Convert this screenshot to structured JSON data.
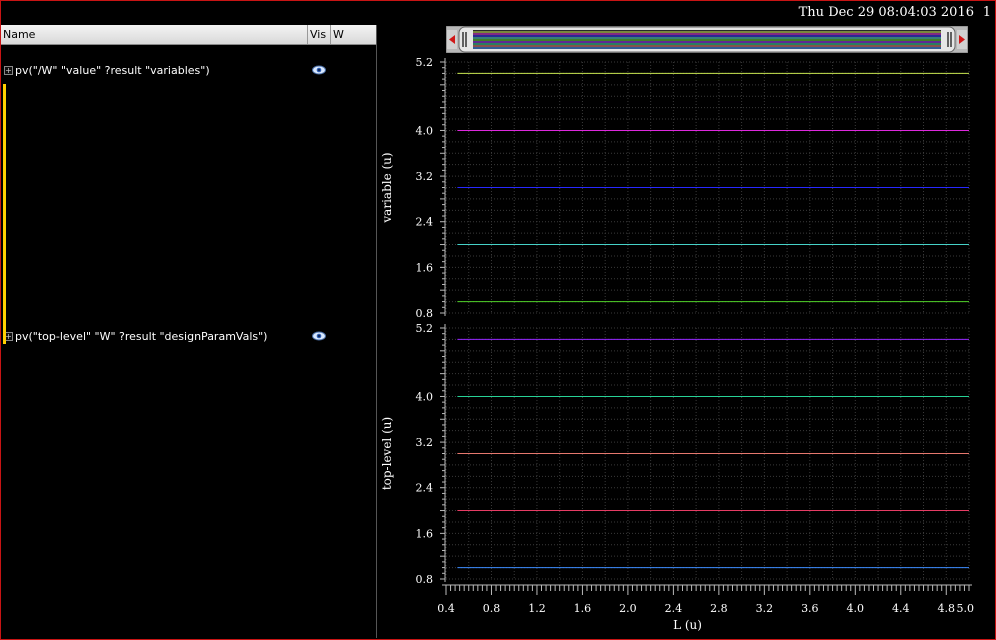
{
  "timestamp": "Thu Dec 29 08:04:03 2016",
  "page_number": "1",
  "browser": {
    "columns": {
      "name": "Name",
      "vis": "Vis",
      "w": "W"
    },
    "rows": [
      {
        "label": "pv(\"/W\" \"value\" ?result \"variables\")",
        "expander": "+"
      },
      {
        "label": "pv(\"top-level\" \"W\" ?result \"designParamVals\")",
        "expander": "+"
      }
    ]
  },
  "colors": {
    "frame": "#c81414",
    "highlight": "#ffd000",
    "grid": "#3a3a3a"
  },
  "chart_data": [
    {
      "type": "line",
      "xlabel": "L (u)",
      "ylabel": "variable (u)",
      "xlim": [
        0.4,
        5.0
      ],
      "ylim": [
        0.8,
        5.2
      ],
      "y_ticks": [
        "0.8",
        "1.6",
        "2.4",
        "3.2",
        "4.0",
        "5.2"
      ],
      "y_tick_values": [
        0.8,
        1.6,
        2.4,
        3.2,
        4.0,
        5.2
      ],
      "grid": true,
      "series": [
        {
          "x": [
            0.5,
            5.0
          ],
          "y": [
            5.0,
            5.0
          ],
          "color": "#c8e650"
        },
        {
          "x": [
            0.5,
            5.0
          ],
          "y": [
            4.0,
            4.0
          ],
          "color": "#dc28dc"
        },
        {
          "x": [
            0.5,
            5.0
          ],
          "y": [
            3.0,
            3.0
          ],
          "color": "#2828ff"
        },
        {
          "x": [
            0.5,
            5.0
          ],
          "y": [
            2.0,
            2.0
          ],
          "color": "#46d2c8"
        },
        {
          "x": [
            0.5,
            5.0
          ],
          "y": [
            1.0,
            1.0
          ],
          "color": "#50d228"
        }
      ]
    },
    {
      "type": "line",
      "xlabel": "L (u)",
      "ylabel": "top-level (u)",
      "xlim": [
        0.4,
        5.0
      ],
      "ylim": [
        0.8,
        5.2
      ],
      "y_ticks": [
        "0.8",
        "1.6",
        "2.4",
        "3.2",
        "4.0",
        "5.2"
      ],
      "y_tick_values": [
        0.8,
        1.6,
        2.4,
        3.2,
        4.0,
        5.2
      ],
      "x_ticks": [
        "0.4",
        "0.8",
        "1.2",
        "1.6",
        "2.0",
        "2.4",
        "2.8",
        "3.2",
        "3.6",
        "4.0",
        "4.4",
        "4.8",
        "5.0"
      ],
      "x_tick_values": [
        0.4,
        0.8,
        1.2,
        1.6,
        2.0,
        2.4,
        2.8,
        3.2,
        3.6,
        4.0,
        4.4,
        4.8,
        5.0
      ],
      "grid": true,
      "series": [
        {
          "x": [
            0.5,
            5.0
          ],
          "y": [
            5.0,
            5.0
          ],
          "color": "#9628ff"
        },
        {
          "x": [
            0.5,
            5.0
          ],
          "y": [
            4.0,
            4.0
          ],
          "color": "#28d296"
        },
        {
          "x": [
            0.5,
            5.0
          ],
          "y": [
            3.0,
            3.0
          ],
          "color": "#e6786e"
        },
        {
          "x": [
            0.5,
            5.0
          ],
          "y": [
            2.0,
            2.0
          ],
          "color": "#e63c64"
        },
        {
          "x": [
            0.5,
            5.0
          ],
          "y": [
            1.0,
            1.0
          ],
          "color": "#3c8cff"
        }
      ]
    }
  ]
}
